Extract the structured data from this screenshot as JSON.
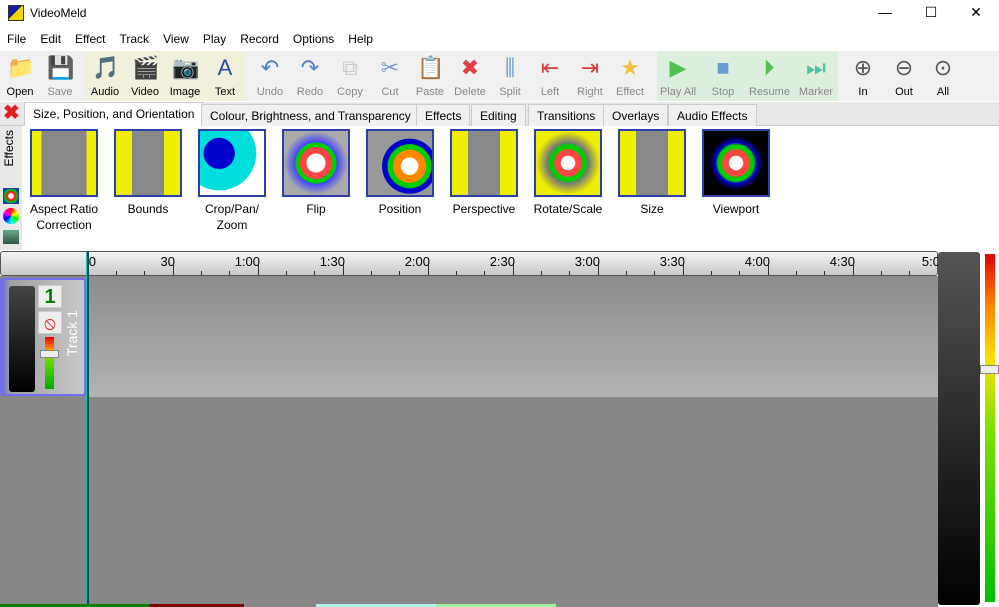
{
  "app": {
    "title": "VideoMeld"
  },
  "window_controls": {
    "minimize": "—",
    "maximize": "☐",
    "close": "✕"
  },
  "menu": [
    "File",
    "Edit",
    "Effect",
    "Track",
    "View",
    "Play",
    "Record",
    "Options",
    "Help"
  ],
  "toolbar": [
    {
      "label": "Open",
      "icon": "folder-icon",
      "enabled": true,
      "glyph": "📁"
    },
    {
      "label": "Save",
      "icon": "floppy-icon",
      "enabled": false,
      "glyph": "💾"
    },
    {
      "label": "Audio",
      "icon": "add-audio-icon",
      "enabled": true,
      "glyph": "🎵"
    },
    {
      "label": "Video",
      "icon": "add-video-icon",
      "enabled": true,
      "glyph": "🎬"
    },
    {
      "label": "Image",
      "icon": "add-image-icon",
      "enabled": true,
      "glyph": "📷"
    },
    {
      "label": "Text",
      "icon": "add-text-icon",
      "enabled": true,
      "glyph": "A"
    },
    {
      "label": "Undo",
      "icon": "undo-icon",
      "enabled": false,
      "glyph": "↶"
    },
    {
      "label": "Redo",
      "icon": "redo-icon",
      "enabled": false,
      "glyph": "↷"
    },
    {
      "label": "Copy",
      "icon": "copy-icon",
      "enabled": false,
      "glyph": "⧉"
    },
    {
      "label": "Cut",
      "icon": "scissors-icon",
      "enabled": false,
      "glyph": "✂"
    },
    {
      "label": "Paste",
      "icon": "paste-icon",
      "enabled": false,
      "glyph": "📋"
    },
    {
      "label": "Delete",
      "icon": "delete-icon",
      "enabled": false,
      "glyph": "✖"
    },
    {
      "label": "Split",
      "icon": "split-icon",
      "enabled": false,
      "glyph": "⫼"
    },
    {
      "label": "Left",
      "icon": "trim-left-icon",
      "enabled": false,
      "glyph": "⇤"
    },
    {
      "label": "Right",
      "icon": "trim-right-icon",
      "enabled": false,
      "glyph": "⇥"
    },
    {
      "label": "Effect",
      "icon": "star-icon",
      "enabled": false,
      "glyph": "★"
    },
    {
      "label": "Play All",
      "icon": "play-icon",
      "enabled": false,
      "glyph": "▶"
    },
    {
      "label": "Stop",
      "icon": "stop-icon",
      "enabled": false,
      "glyph": "■"
    },
    {
      "label": "Resume",
      "icon": "resume-icon",
      "enabled": false,
      "glyph": "⏵"
    },
    {
      "label": "Marker",
      "icon": "marker-icon",
      "enabled": false,
      "glyph": "⏭"
    },
    {
      "label": "In",
      "icon": "zoom-in-icon",
      "enabled": true,
      "glyph": "⊕"
    },
    {
      "label": "Out",
      "icon": "zoom-out-icon",
      "enabled": true,
      "glyph": "⊖"
    },
    {
      "label": "All",
      "icon": "zoom-all-icon",
      "enabled": true,
      "glyph": "⊙"
    }
  ],
  "tabs": [
    {
      "label": "Size, Position, and Orientation",
      "active": true
    },
    {
      "label": "Colour, Brightness, and Transparency"
    },
    {
      "label": "Effects"
    },
    {
      "label": "Editing"
    },
    {
      "label": "Transitions"
    },
    {
      "label": "Overlays"
    },
    {
      "label": "Audio Effects"
    }
  ],
  "side_label": "Effects",
  "effects": [
    "Aspect Ratio Correction",
    "Bounds",
    "Crop/Pan/ Zoom",
    "Flip",
    "Position",
    "Perspective",
    "Rotate/Scale",
    "Size",
    "Viewport"
  ],
  "ruler": [
    "0",
    "30",
    "1:00",
    "1:30",
    "2:00",
    "2:30",
    "3:00",
    "3:30",
    "4:00",
    "4:30",
    "5:0"
  ],
  "track": {
    "number": "1",
    "name": "Track 1",
    "mute_icon": "no-entry-icon"
  },
  "colors": {
    "accent": "#2d3ea8",
    "toolbar_group_add": "#f0f0dc",
    "toolbar_group_play": "#dcefdc"
  }
}
